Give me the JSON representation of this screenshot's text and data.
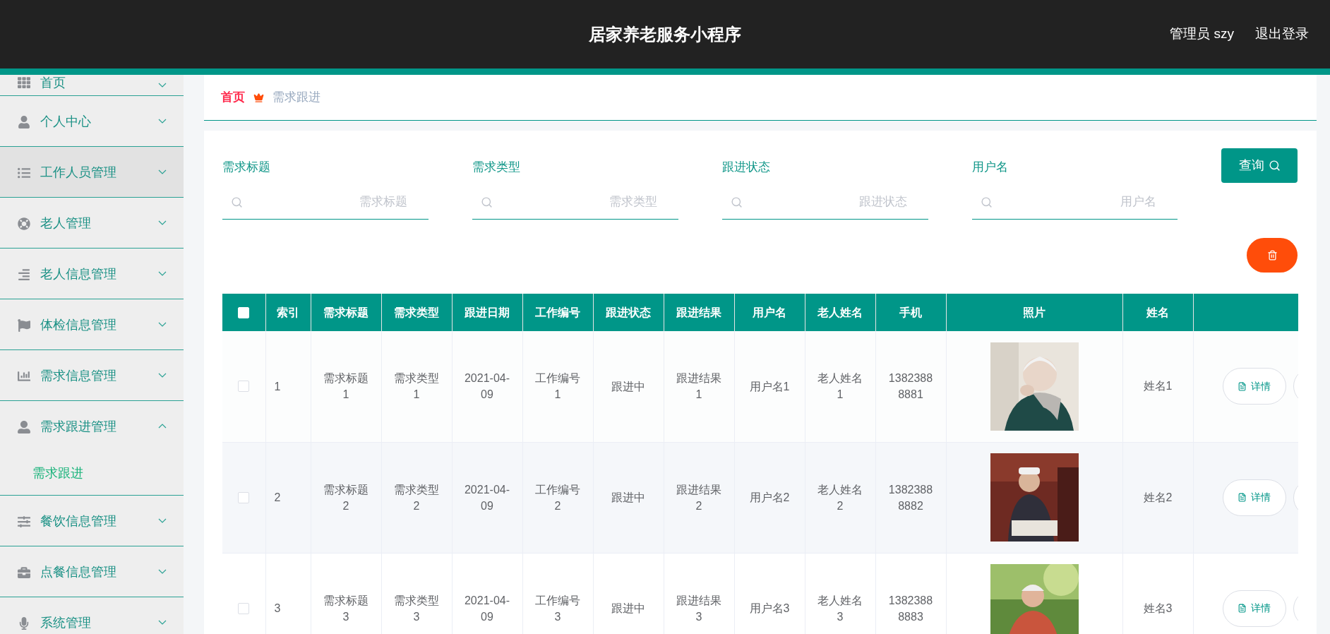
{
  "header": {
    "title": "居家养老服务小程序",
    "user": "管理员 szy",
    "logout": "退出登录"
  },
  "sidebar": {
    "items": [
      {
        "label": "首页",
        "expanded": false,
        "highlighted": false
      },
      {
        "label": "个人中心",
        "expanded": false,
        "highlighted": false
      },
      {
        "label": "工作人员管理",
        "expanded": false,
        "highlighted": true
      },
      {
        "label": "老人管理",
        "expanded": false,
        "highlighted": false
      },
      {
        "label": "老人信息管理",
        "expanded": false,
        "highlighted": false
      },
      {
        "label": "体检信息管理",
        "expanded": false,
        "highlighted": false
      },
      {
        "label": "需求信息管理",
        "expanded": false,
        "highlighted": false
      },
      {
        "label": "需求跟进管理",
        "expanded": true,
        "highlighted": false,
        "children": [
          {
            "label": "需求跟进",
            "selected": true
          }
        ]
      },
      {
        "label": "餐饮信息管理",
        "expanded": false,
        "highlighted": false
      },
      {
        "label": "点餐信息管理",
        "expanded": false,
        "highlighted": false
      },
      {
        "label": "系统管理",
        "expanded": false,
        "highlighted": false
      }
    ]
  },
  "breadcrumb": [
    {
      "label": "首页",
      "current": false
    },
    {
      "label": "需求跟进",
      "current": true
    }
  ],
  "search": {
    "fields": [
      {
        "label": "需求标题",
        "placeholder": "需求标题"
      },
      {
        "label": "需求类型",
        "placeholder": "需求类型"
      },
      {
        "label": "跟进状态",
        "placeholder": "跟进状态"
      },
      {
        "label": "用户名",
        "placeholder": "用户名"
      }
    ],
    "button": "查询"
  },
  "table": {
    "all_checked": false,
    "columns": [
      "索引",
      "需求标题",
      "需求类型",
      "跟进日期",
      "工作编号",
      "跟进状态",
      "跟进结果",
      "用户名",
      "老人姓名",
      "手机",
      "照片",
      "姓名"
    ],
    "rows": [
      {
        "checked": false,
        "cells": [
          "1",
          "需求标题1",
          "需求类型1",
          "2021-04-09",
          "工作编号1",
          "跟进中",
          "跟进结果1",
          "用户名1",
          "老人姓名1",
          "13823888881"
        ],
        "photo": {
          "kind": "picture"
        },
        "name": "姓名1",
        "action": "详情"
      },
      {
        "checked": false,
        "cells": [
          "2",
          "需求标题2",
          "需求类型2",
          "2021-04-09",
          "工作编号2",
          "跟进中",
          "跟进结果2",
          "用户名2",
          "老人姓名2",
          "13823888882"
        ],
        "photo": {
          "kind": "picture"
        },
        "name": "姓名2",
        "action": "详情"
      },
      {
        "checked": false,
        "cells": [
          "3",
          "需求标题3",
          "需求类型3",
          "2021-04-09",
          "工作编号3",
          "跟进中",
          "跟进结果3",
          "用户名3",
          "老人姓名3",
          "13823888883"
        ],
        "photo": {
          "kind": "picture"
        },
        "name": "姓名3",
        "action": "详情"
      }
    ]
  }
}
